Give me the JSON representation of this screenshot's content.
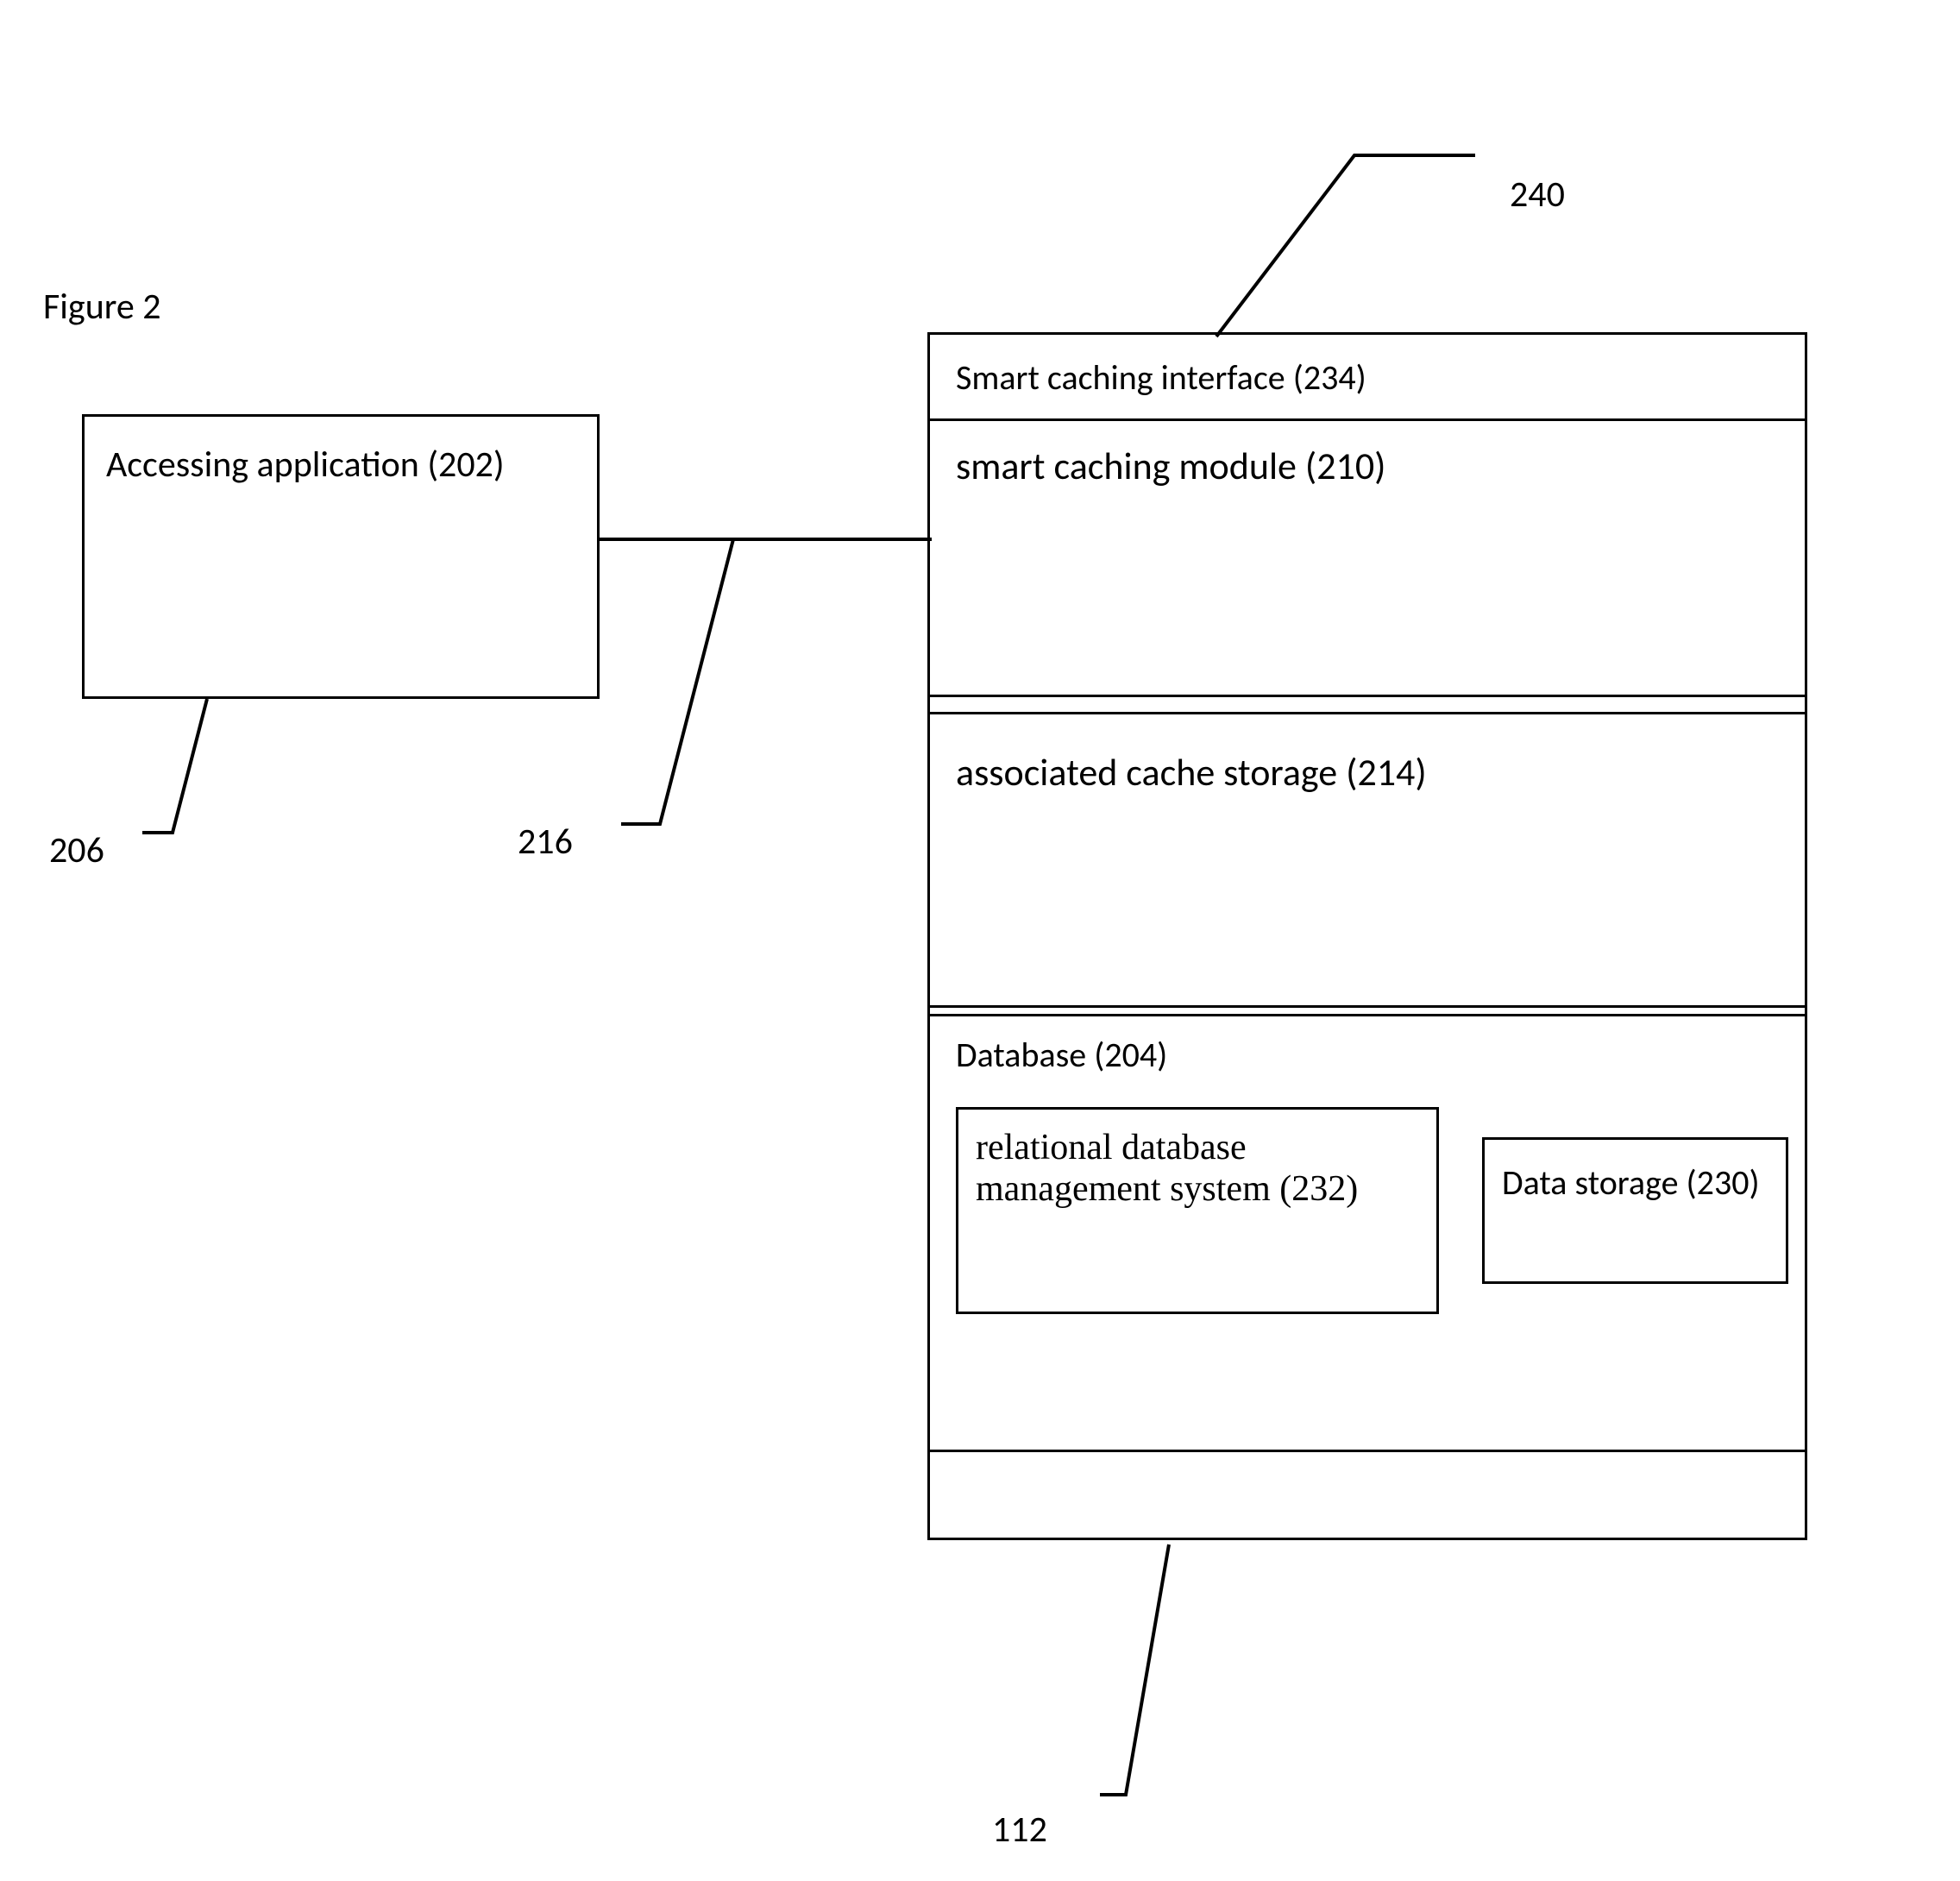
{
  "figure_title": "Figure 2",
  "boxes": {
    "accessing_application": "Accessing application (202)",
    "smart_caching_interface": "Smart caching interface (234)",
    "smart_caching_module": "smart caching module (210)",
    "associated_cache_storage": "associated cache storage (214)",
    "database": "Database (204)",
    "rdbms": "relational database management system (232)",
    "data_storage": "Data storage (230)"
  },
  "reference_labels": {
    "r240": "240",
    "r206": "206",
    "r216": "216",
    "r112": "112"
  }
}
